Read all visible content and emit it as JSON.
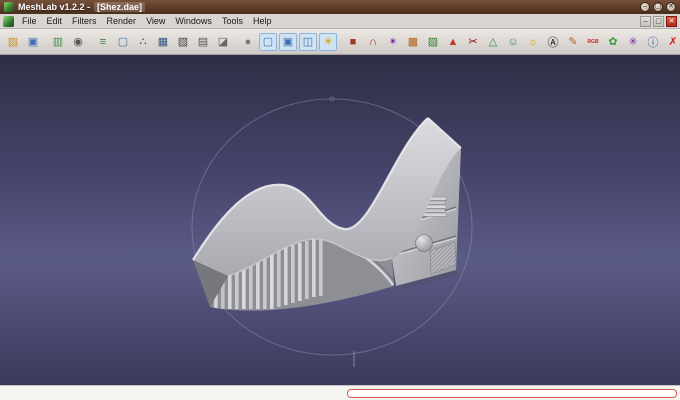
{
  "window": {
    "title_app": "MeshLab v1.2.2 -",
    "title_doc": "[Shez.dae]",
    "controls": {
      "minimize": "–",
      "maximize": "▢",
      "close": "✕"
    }
  },
  "menubar": {
    "items": [
      "File",
      "Edit",
      "Filters",
      "Render",
      "View",
      "Windows",
      "Tools",
      "Help"
    ],
    "mdi": {
      "minimize": "–",
      "restore": "▢",
      "close": "✕"
    }
  },
  "toolbar": {
    "icons": [
      {
        "name": "open-icon",
        "glyph": "▨",
        "color": "#c8962c"
      },
      {
        "name": "save-icon",
        "glyph": "▣",
        "color": "#3f6fae"
      },
      {
        "name": "export-mesh-icon",
        "glyph": "▥",
        "color": "#3f8f4f",
        "gap": true
      },
      {
        "name": "snapshot-icon",
        "glyph": "◉",
        "color": "#555555"
      },
      {
        "name": "layers-icon",
        "glyph": "≡",
        "color": "#3f7f3f",
        "gap": true
      },
      {
        "name": "bbox-icon",
        "glyph": "▢",
        "color": "#4a6fa5"
      },
      {
        "name": "points-icon",
        "glyph": "∴",
        "color": "#333333"
      },
      {
        "name": "wireframe-icon",
        "glyph": "▦",
        "color": "#335588"
      },
      {
        "name": "hidden-lines-icon",
        "glyph": "▧",
        "color": "#444444"
      },
      {
        "name": "flat-lines-icon",
        "glyph": "▤",
        "color": "#555555"
      },
      {
        "name": "flat-shading-icon",
        "glyph": "◪",
        "color": "#666666"
      },
      {
        "name": "smooth-shading-icon",
        "glyph": "●",
        "color": "#7a7a7a",
        "gap": true
      },
      {
        "name": "ortho-view-icon",
        "glyph": "▢",
        "color": "#3f6fae",
        "pressed": true
      },
      {
        "name": "perspective-view-icon",
        "glyph": "▣",
        "color": "#3f6fae",
        "pressed": true
      },
      {
        "name": "trackball-icon",
        "glyph": "◫",
        "color": "#3f6fae",
        "pressed": true
      },
      {
        "name": "light-icon",
        "glyph": "☀",
        "color": "#d8a500",
        "pressed": true
      },
      {
        "name": "backface-cull-icon",
        "glyph": "■",
        "color": "#a03a2a",
        "gap": true
      },
      {
        "name": "snap-icon",
        "glyph": "∩",
        "color": "#b03030"
      },
      {
        "name": "decorators-icon",
        "glyph": "✴",
        "color": "#7b1fa2"
      },
      {
        "name": "background-image-icon",
        "glyph": "▩",
        "color": "#b5651d"
      },
      {
        "name": "texture-image-icon",
        "glyph": "▨",
        "color": "#2e7d32"
      },
      {
        "name": "mesh-quality-icon",
        "glyph": "▲",
        "color": "#c0392b"
      },
      {
        "name": "cut-mesh-icon",
        "glyph": "✂",
        "color": "#8b0000"
      },
      {
        "name": "select-face-icon",
        "glyph": "△",
        "color": "#2e8b57"
      },
      {
        "name": "smooth-surface-icon",
        "glyph": "☺",
        "color": "#2e8b57"
      },
      {
        "name": "fancy-light-icon",
        "glyph": "☼",
        "color": "#d8a500"
      },
      {
        "name": "ambient-occlusion-icon",
        "glyph": "Ⓐ",
        "color": "#111111"
      },
      {
        "name": "paint-icon",
        "glyph": "✎",
        "color": "#b8651b"
      },
      {
        "name": "rgb-paint-icon",
        "glyph": "RGB",
        "color": "#cc2222",
        "small": true
      },
      {
        "name": "color-fill-icon",
        "glyph": "✿",
        "color": "#3a9a3a"
      },
      {
        "name": "splat-icon",
        "glyph": "✳",
        "color": "#7b1fa2"
      },
      {
        "name": "info-icon",
        "glyph": "ⓘ",
        "color": "#2255aa"
      },
      {
        "name": "delete-mesh-icon",
        "glyph": "✗",
        "color": "#cc2222"
      },
      {
        "name": "toolbar-overflow-icon",
        "glyph": "»",
        "color": "#666666",
        "gap": true
      }
    ]
  },
  "viewport": {
    "bg_top": "#2e2e46",
    "bg_mid": "#5b5b87",
    "bg_bottom": "#3a3a5b",
    "model_color": "#c0c0c6",
    "trackball_color": "#9a9ab8"
  },
  "statusbar": {
    "progress_outline": "#d2604a",
    "progress_value": ""
  }
}
